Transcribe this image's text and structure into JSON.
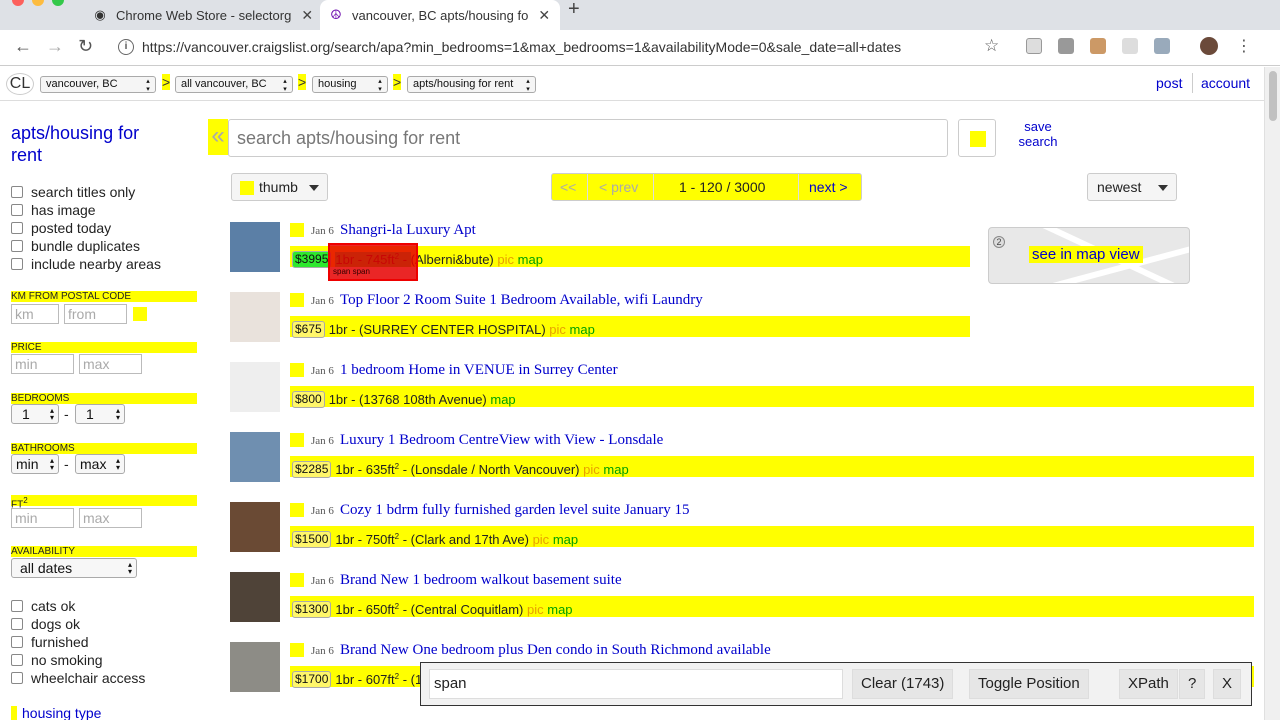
{
  "browser": {
    "tabs": [
      {
        "title": "Chrome Web Store - selectorg",
        "icon": "chrome-icon"
      },
      {
        "title": "vancouver, BC apts/housing fo",
        "icon": "peace-icon"
      }
    ],
    "url": "https://vancouver.craigslist.org/search/apa?min_bedrooms=1&max_bedrooms=1&availabilityMode=0&sale_date=all+dates"
  },
  "topnav": {
    "logo": "CL",
    "crumbs": [
      "vancouver, BC",
      "all vancouver, BC",
      "housing",
      "apts/housing for rent"
    ],
    "sep": ">",
    "post": "post",
    "account": "account"
  },
  "sidebar": {
    "title": "apts/housing for rent",
    "checks": [
      "search titles only",
      "has image",
      "posted today",
      "bundle duplicates",
      "include nearby areas"
    ],
    "km_label": "KM FROM POSTAL CODE",
    "km_placeholder": "km",
    "postal_placeholder": "from post",
    "price_label": "PRICE",
    "min_placeholder": "min",
    "max_placeholder": "max",
    "bedrooms_label": "BEDROOMS",
    "bed_min": "1",
    "bed_max": "1",
    "bathrooms_label": "BATHROOMS",
    "bath_min": "min",
    "bath_max": "max",
    "ft_label": "FT",
    "ft_sup": "2",
    "availability_label": "AVAILABILITY",
    "availability_value": "all dates",
    "dash": "-",
    "checks2": [
      "cats ok",
      "dogs ok",
      "furnished",
      "no smoking",
      "wheelchair access"
    ],
    "housing_type": "housing type"
  },
  "search": {
    "placeholder": "search apts/housing for rent",
    "save": "save search",
    "collapse": "«"
  },
  "controls": {
    "view": "thumb",
    "first": "<<",
    "prev": "< prev",
    "range": "1 - 120 / 3000",
    "next": "next >",
    "sort": "newest"
  },
  "mapview": {
    "label": "see in map view",
    "marker": "2"
  },
  "results": [
    {
      "date": "Jan 6",
      "title": "Shangri-la Luxury Apt",
      "price": "$3995",
      "housing": "1br - 745ft",
      "sup": "2",
      "dash": " - ",
      "hood": "(Alberni&bute)",
      "pic": "pic",
      "map": "map",
      "img": "#5b7fa6"
    },
    {
      "date": "Jan 6",
      "title": "Top Floor 2 Room Suite 1 Bedroom Available, wifi Laundry",
      "price": "$675",
      "housing": "1br - ",
      "sup": "",
      "dash": "",
      "hood": "(SURREY CENTER HOSPITAL)",
      "pic": "pic",
      "map": "map",
      "img": "#e9e2dc"
    },
    {
      "date": "Jan 6",
      "title": "1 bedroom Home in VENUE in Surrey Center",
      "price": "$800",
      "housing": "1br - ",
      "sup": "",
      "dash": "",
      "hood": "(13768 108th Avenue)",
      "pic": "",
      "map": "map",
      "img": "#eeeeee"
    },
    {
      "date": "Jan 6",
      "title": "Luxury 1 Bedroom CentreView with View - Lonsdale",
      "price": "$2285",
      "housing": "1br - 635ft",
      "sup": "2",
      "dash": " - ",
      "hood": "(Lonsdale / North Vancouver)",
      "pic": "pic",
      "map": "map",
      "img": "#6f8fb0"
    },
    {
      "date": "Jan 6",
      "title": "Cozy 1 bdrm fully furnished garden level suite January 15",
      "price": "$1500",
      "housing": "1br - 750ft",
      "sup": "2",
      "dash": " - ",
      "hood": "(Clark and 17th Ave)",
      "pic": "pic",
      "map": "map",
      "img": "#6a4a34"
    },
    {
      "date": "Jan 6",
      "title": "Brand New 1 bedroom walkout basement suite",
      "price": "$1300",
      "housing": "1br - 650ft",
      "sup": "2",
      "dash": " - ",
      "hood": "(Central Coquitlam)",
      "pic": "pic",
      "map": "map",
      "img": "#4f4338"
    },
    {
      "date": "Jan 6",
      "title": "Brand New One bedroom plus Den condo in South Richmond available",
      "price": "$1700",
      "housing": "1br - 607ft",
      "sup": "2",
      "dash": " - ",
      "hood": "(1",
      "pic": "",
      "map": "",
      "img": "#8d8c86"
    }
  ],
  "selector_gadget": {
    "hint": "span span",
    "selector": "span",
    "clear": "Clear (1743)",
    "toggle": "Toggle Position",
    "xpath": "XPath",
    "help": "?",
    "close": "X"
  },
  "colors": {
    "highlight": "#ffff00",
    "selected": "#2ee82e",
    "rejected": "#e60000",
    "link": "#0000cc"
  }
}
